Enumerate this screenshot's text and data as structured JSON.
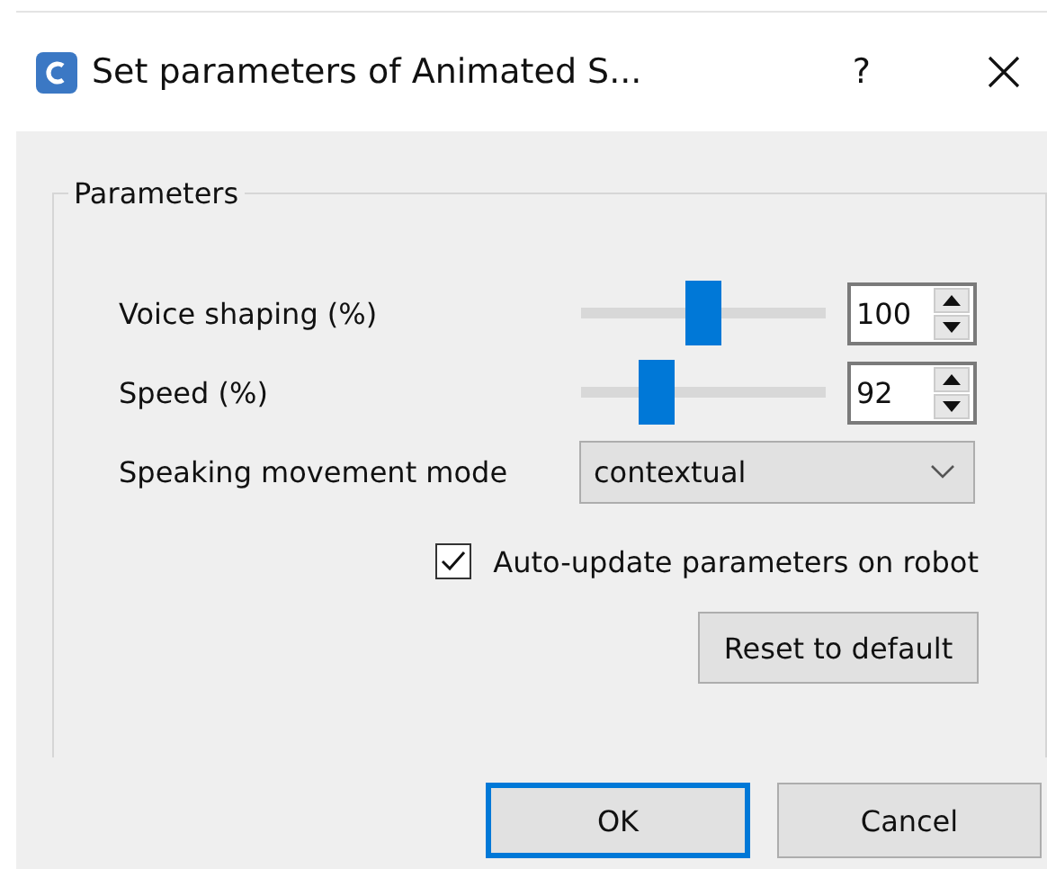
{
  "window": {
    "title": "Set parameters of Animated S...",
    "help": "?"
  },
  "group": {
    "title": "Parameters"
  },
  "sliders": [
    {
      "label": "Voice shaping (%)",
      "level": 0.5,
      "value": "100"
    },
    {
      "label": "Speed (%)",
      "level": 0.28,
      "value": "92"
    }
  ],
  "mode": {
    "label": "Speaking movement mode",
    "value": "contextual"
  },
  "auto_update": {
    "label": "Auto-update parameters on robot",
    "checked": true
  },
  "reset_button": "Reset to default",
  "buttons": [
    {
      "label": "OK",
      "selected": true
    },
    {
      "label": "Cancel",
      "selected": false
    }
  ]
}
